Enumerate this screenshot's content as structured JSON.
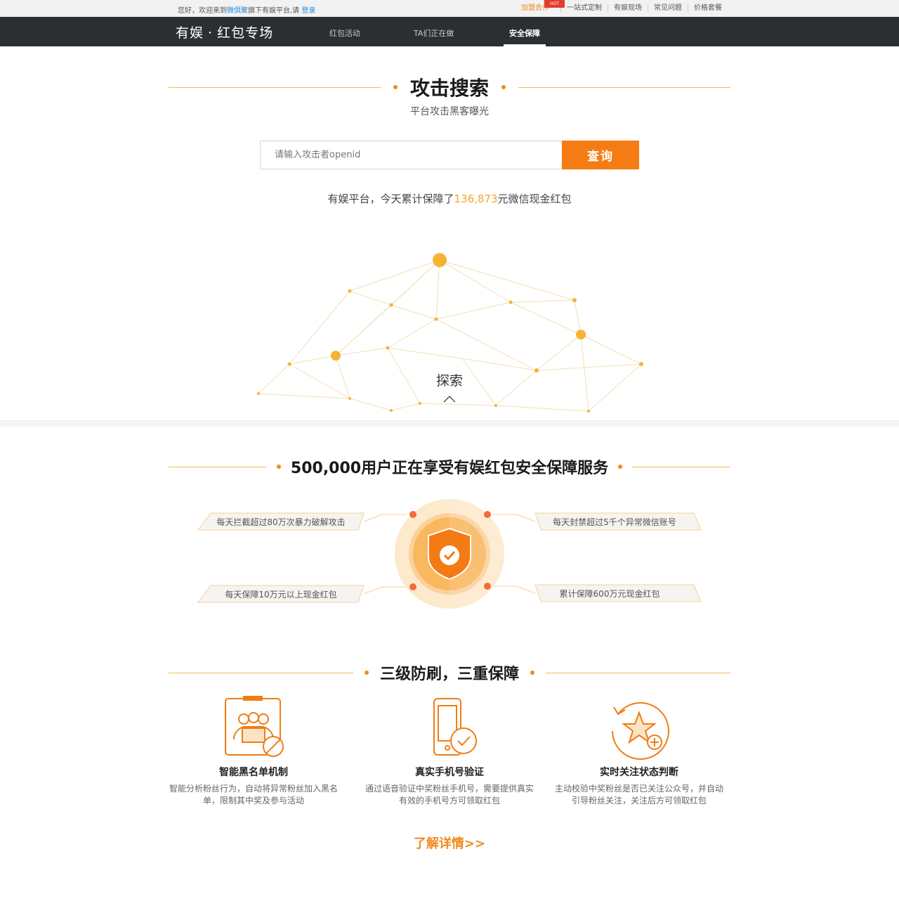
{
  "topbar": {
    "welcome_prefix": "您好，欢迎来到",
    "welcome_brand": "微俱聚",
    "welcome_suffix": "旗下有娱平台,请",
    "login": "登录",
    "links": [
      "加盟合作",
      "一站式定制",
      "有娱现场",
      "常见问题",
      "价格套餐"
    ],
    "hot_badge": "HOT"
  },
  "nav": {
    "logo_brand": "有娱",
    "logo_dot": "·",
    "logo_title": "红包专场",
    "tabs": [
      "红包活动",
      "TA们正在做",
      "安全保障"
    ],
    "active_tab": "安全保障"
  },
  "search_section": {
    "title": "攻击搜索",
    "subtitle": "平台攻击黑客曝光",
    "placeholder": "请输入攻击者openid",
    "button": "查询",
    "stat_prefix": "有娱平台，今天累计保障了",
    "stat_number": "136,873",
    "stat_suffix": "元微信现金红包",
    "explore": "探索"
  },
  "service_section": {
    "title": "500,000用户正在享受有娱红包安全保障服务",
    "features": [
      "每天拦截超过80万次暴力破解攻击",
      "每天封禁超过5千个异常微信账号",
      "每天保障10万元以上现金红包",
      "累计保障600万元现金红包"
    ]
  },
  "protection_section": {
    "title": "三级防刷，三重保障",
    "items": [
      {
        "icon": "blacklist-users-icon",
        "title": "智能黑名单机制",
        "desc": "智能分析粉丝行为，自动将异常粉丝加入黑名单，限制其中奖及参与活动"
      },
      {
        "icon": "phone-check-icon",
        "title": "真实手机号验证",
        "desc": "通过语音验证中奖粉丝手机号，需要提供真实有效的手机号方可领取红包"
      },
      {
        "icon": "star-follow-icon",
        "title": "实时关注状态判断",
        "desc": "主动校验中奖粉丝是否已关注公众号，并自动引导粉丝关注，关注后方可领取红包"
      }
    ],
    "more": "了解详情>>"
  },
  "colors": {
    "accent": "#f57c14",
    "accent_light": "#f5a623",
    "nav_bg": "#2b2e32",
    "link_blue": "#2a8bd8"
  }
}
